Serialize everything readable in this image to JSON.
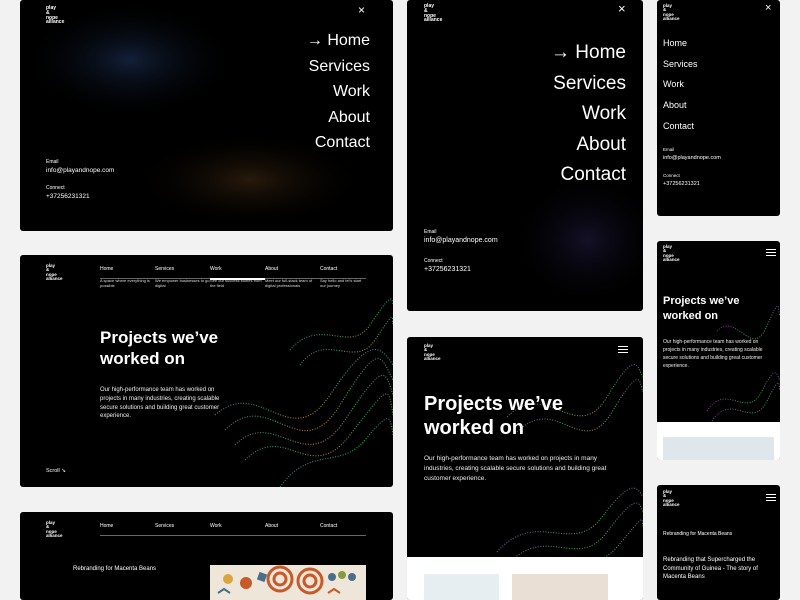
{
  "logo": [
    "play",
    "&",
    "nope",
    "alliance"
  ],
  "menu": {
    "items": [
      "→ Home",
      "Services",
      "Work",
      "About",
      "Contact"
    ],
    "items_plain": [
      "Home",
      "Services",
      "Work",
      "About",
      "Contact"
    ],
    "email_label": "Email",
    "email": "info@playandnope.com",
    "connect_label": "Connect",
    "phone": "+37256231321",
    "close_glyph": "×"
  },
  "nav": {
    "items": [
      {
        "label": "Home",
        "desc": "A space where everything is possible"
      },
      {
        "label": "Services",
        "desc": "We empower businesses to go digital"
      },
      {
        "label": "Work",
        "desc": "See our success stories from the field"
      },
      {
        "label": "About",
        "desc": "Meet our full-stack team of digital professionals"
      },
      {
        "label": "Contact",
        "desc": "Say hello and let's start our journey"
      }
    ]
  },
  "hero": {
    "title_line1": "Projects we’ve",
    "title_line2": "worked on",
    "body": "Our high-performance team has worked on projects in many industries, creating scalable secure solutions and building great customer experience.",
    "scroll": "Scroll ↘"
  },
  "project": {
    "title": "Rebranding for Macenta Beans",
    "subtitle": "Rebranding that Supercharged the Community of Guinea - The story of Macenta Beans"
  },
  "colors": {
    "background": "#f2f2f2",
    "panel": "#000000",
    "text": "#ffffff"
  }
}
